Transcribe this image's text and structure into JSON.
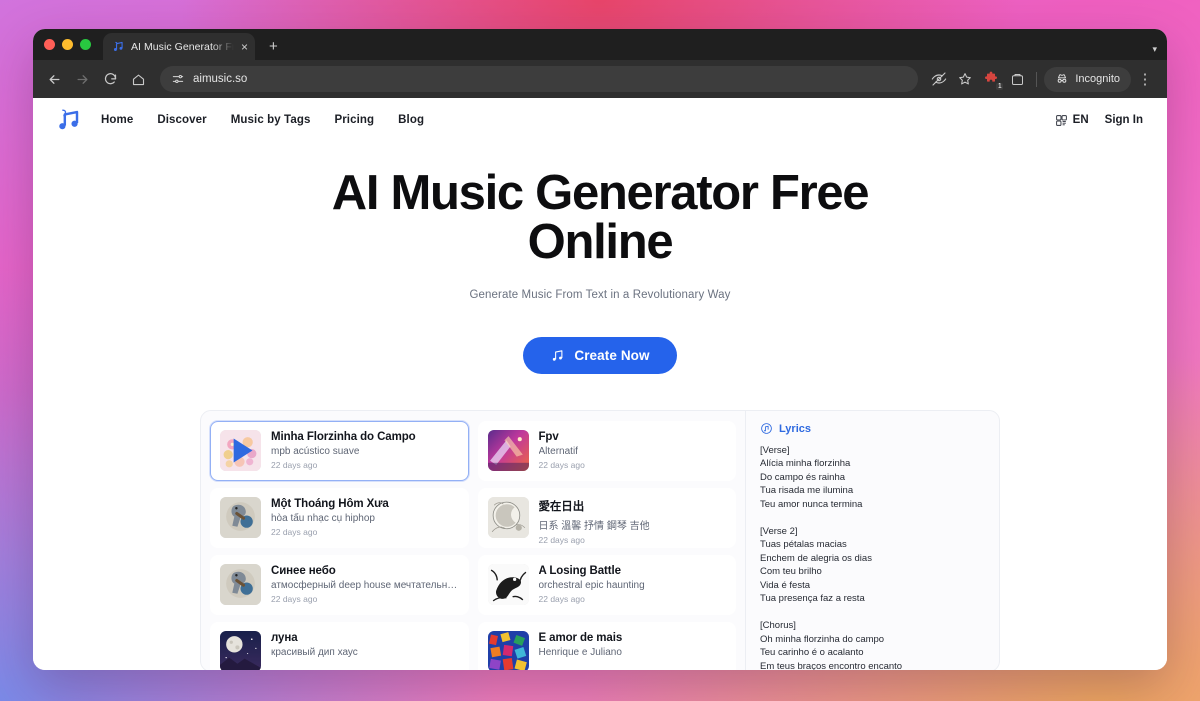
{
  "browser": {
    "tab": {
      "title": "AI Music Generator Free Onlin",
      "close_label": "×"
    },
    "new_tab_label": "+",
    "tabstrip_chevron": "▾",
    "back_label": "←",
    "forward_label": "→",
    "reload_label": "⟳",
    "home_label": "⌂",
    "url": "aimusic.so",
    "extension_badge": "1",
    "incognito_label": "Incognito",
    "menu_label": "⋮"
  },
  "site_nav": {
    "links": [
      {
        "label": "Home"
      },
      {
        "label": "Discover"
      },
      {
        "label": "Music by Tags"
      },
      {
        "label": "Pricing"
      },
      {
        "label": "Blog"
      }
    ],
    "language": "EN",
    "sign_in": "Sign In"
  },
  "hero": {
    "title": "AI Music Generator Free Online",
    "subtitle": "Generate Music From Text in a Revolutionary Way",
    "cta_label": "Create Now"
  },
  "showcase": {
    "songs": [
      {
        "title": "Minha Florzinha do Campo",
        "tags": "mpb acústico suave",
        "date": "22 days ago",
        "art": "flowers",
        "selected": true,
        "playing": true
      },
      {
        "title": "Fpv",
        "tags": "Alternatif",
        "date": "22 days ago",
        "art": "comet",
        "selected": false,
        "playing": false
      },
      {
        "title": "Một Thoáng Hôm Xưa",
        "tags": "hòa tấu nhạc cụ hiphop",
        "date": "22 days ago",
        "art": "guitarbird",
        "selected": false,
        "playing": false
      },
      {
        "title": "愛在日出",
        "tags": "日系 溫馨 抒情 鋼琴 吉他",
        "date": "22 days ago",
        "art": "moonline",
        "selected": false,
        "playing": false
      },
      {
        "title": "Синее небо",
        "tags": "атмосферный deep house мечтательный",
        "date": "22 days ago",
        "art": "guitarbird",
        "selected": false,
        "playing": false
      },
      {
        "title": "A Losing Battle",
        "tags": "orchestral epic haunting",
        "date": "22 days ago",
        "art": "inkbird",
        "selected": false,
        "playing": false
      },
      {
        "title": "луна",
        "tags": "красивый дип хаус",
        "date": "",
        "art": "moonnight",
        "selected": false,
        "playing": false
      },
      {
        "title": "É amor de mais",
        "tags": "Henrique e Juliano",
        "date": "",
        "art": "confetti",
        "selected": false,
        "playing": false
      }
    ],
    "lyrics_header": "Lyrics",
    "lyrics": "[Verse]\nAlícia minha florzinha\nDo campo és rainha\nTua risada me ilumina\nTeu amor nunca termina\n\n[Verse 2]\nTuas pétalas macias\nEnchem de alegria os dias\nCom teu brilho\nVida é festa\nTua presença faz a resta\n\n[Chorus]\nOh minha florzinha do campo\nTeu carinho é o acalanto\nEm teus braços encontro encanto"
  },
  "colors": {
    "accent_blue": "#2563eb",
    "lyrics_blue": "#2f6ae0",
    "selected_border": "#93b0f5"
  }
}
